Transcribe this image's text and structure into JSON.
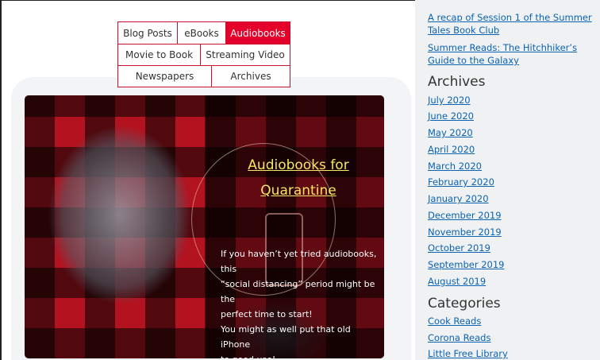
{
  "filter_tabs": [
    {
      "label": "Blog Posts",
      "active": false
    },
    {
      "label": "eBooks",
      "active": false
    },
    {
      "label": "Audiobooks",
      "active": true
    },
    {
      "label": "Movie to Book",
      "active": false
    },
    {
      "label": "Streaming Video",
      "active": false
    },
    {
      "label": "Newspapers",
      "active": false
    },
    {
      "label": "Archives",
      "active": false
    }
  ],
  "hero": {
    "title": "Audiobooks for Quarantine",
    "title_line1": "Audiobooks for",
    "title_line2": "Quarantine",
    "lines": [
      "If you haven’t yet tried audiobooks, this",
      "“social distancing” period might be the",
      "perfect time to start!",
      "You might as well put that old iPhone",
      "to good use!"
    ]
  },
  "sidebar": {
    "recent_posts": [
      "A recap of Session 1 of the Summer Tales Book Club",
      "Summer Reads: The Hitchhiker’s Guide to the Galaxy"
    ],
    "archives_heading": "Archives",
    "archives": [
      "July 2020",
      "June 2020",
      "May 2020",
      "April 2020",
      "March 2020",
      "February 2020",
      "January 2020",
      "December 2019",
      "November 2019",
      "October 2019",
      "September 2019",
      "August 2019"
    ],
    "categories_heading": "Categories",
    "categories": [
      "Cook Reads",
      "Corona Reads",
      "Little Free Library"
    ]
  },
  "colors": {
    "accent": "#e4002b",
    "link": "#0b63b3",
    "title_yellow": "#f5e663"
  }
}
